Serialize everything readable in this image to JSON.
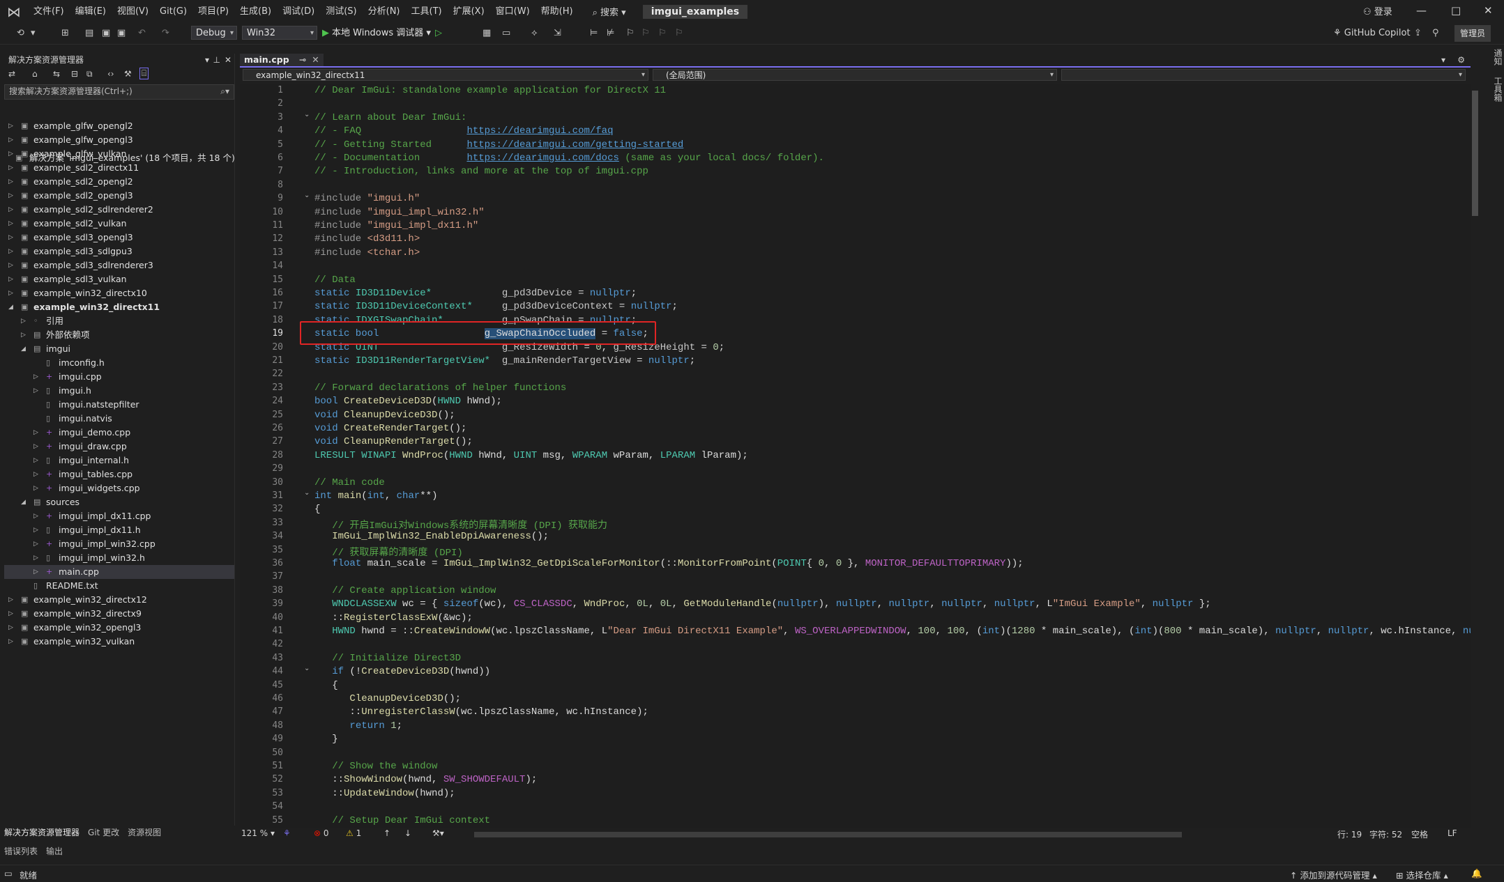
{
  "titlebar": {
    "menus": [
      "文件(F)",
      "编辑(E)",
      "视图(V)",
      "Git(G)",
      "项目(P)",
      "生成(B)",
      "调试(D)",
      "测试(S)",
      "分析(N)",
      "工具(T)",
      "扩展(X)",
      "窗口(W)",
      "帮助(H)"
    ],
    "search": "搜索",
    "solution_name": "imgui_examples",
    "login": "登录",
    "minimize": "—",
    "maximize": "□",
    "close": "✕"
  },
  "toolbar": {
    "config": "Debug",
    "platform": "Win32",
    "run_label": "本地 Windows 调试器",
    "copilot": "GitHub Copilot",
    "manage": "管理员"
  },
  "solution_explorer": {
    "title": "解决方案资源管理器",
    "search_placeholder": "搜索解决方案资源管理器(Ctrl+;)",
    "solution_label": "解决方案 'imgui_examples' (18 个项目，共 18 个)",
    "items": [
      {
        "label": "example_glfw_opengl2",
        "depth": 0,
        "arrow": "closed",
        "icon": "project"
      },
      {
        "label": "example_glfw_opengl3",
        "depth": 0,
        "arrow": "closed",
        "icon": "project"
      },
      {
        "label": "example_glfw_vulkan",
        "depth": 0,
        "arrow": "closed",
        "icon": "project"
      },
      {
        "label": "example_sdl2_directx11",
        "depth": 0,
        "arrow": "closed",
        "icon": "project"
      },
      {
        "label": "example_sdl2_opengl2",
        "depth": 0,
        "arrow": "closed",
        "icon": "project"
      },
      {
        "label": "example_sdl2_opengl3",
        "depth": 0,
        "arrow": "closed",
        "icon": "project"
      },
      {
        "label": "example_sdl2_sdlrenderer2",
        "depth": 0,
        "arrow": "closed",
        "icon": "project"
      },
      {
        "label": "example_sdl2_vulkan",
        "depth": 0,
        "arrow": "closed",
        "icon": "project"
      },
      {
        "label": "example_sdl3_opengl3",
        "depth": 0,
        "arrow": "closed",
        "icon": "project"
      },
      {
        "label": "example_sdl3_sdlgpu3",
        "depth": 0,
        "arrow": "closed",
        "icon": "project"
      },
      {
        "label": "example_sdl3_sdlrenderer3",
        "depth": 0,
        "arrow": "closed",
        "icon": "project"
      },
      {
        "label": "example_sdl3_vulkan",
        "depth": 0,
        "arrow": "closed",
        "icon": "project"
      },
      {
        "label": "example_win32_directx10",
        "depth": 0,
        "arrow": "closed",
        "icon": "project"
      },
      {
        "label": "example_win32_directx11",
        "depth": 0,
        "arrow": "open",
        "icon": "project",
        "bold": true
      },
      {
        "label": "引用",
        "depth": 1,
        "arrow": "closed",
        "icon": "ref"
      },
      {
        "label": "外部依赖项",
        "depth": 1,
        "arrow": "closed",
        "icon": "folder"
      },
      {
        "label": "imgui",
        "depth": 1,
        "arrow": "open",
        "icon": "folder"
      },
      {
        "label": "imconfig.h",
        "depth": 2,
        "arrow": "none",
        "icon": "file"
      },
      {
        "label": "imgui.cpp",
        "depth": 2,
        "arrow": "closed",
        "icon": "cpp"
      },
      {
        "label": "imgui.h",
        "depth": 2,
        "arrow": "closed",
        "icon": "file"
      },
      {
        "label": "imgui.natstepfilter",
        "depth": 2,
        "arrow": "none",
        "icon": "file"
      },
      {
        "label": "imgui.natvis",
        "depth": 2,
        "arrow": "none",
        "icon": "file"
      },
      {
        "label": "imgui_demo.cpp",
        "depth": 2,
        "arrow": "closed",
        "icon": "cpp"
      },
      {
        "label": "imgui_draw.cpp",
        "depth": 2,
        "arrow": "closed",
        "icon": "cpp"
      },
      {
        "label": "imgui_internal.h",
        "depth": 2,
        "arrow": "closed",
        "icon": "file"
      },
      {
        "label": "imgui_tables.cpp",
        "depth": 2,
        "arrow": "closed",
        "icon": "cpp"
      },
      {
        "label": "imgui_widgets.cpp",
        "depth": 2,
        "arrow": "closed",
        "icon": "cpp"
      },
      {
        "label": "sources",
        "depth": 1,
        "arrow": "open",
        "icon": "folder"
      },
      {
        "label": "imgui_impl_dx11.cpp",
        "depth": 2,
        "arrow": "closed",
        "icon": "cpp"
      },
      {
        "label": "imgui_impl_dx11.h",
        "depth": 2,
        "arrow": "closed",
        "icon": "file"
      },
      {
        "label": "imgui_impl_win32.cpp",
        "depth": 2,
        "arrow": "closed",
        "icon": "cpp"
      },
      {
        "label": "imgui_impl_win32.h",
        "depth": 2,
        "arrow": "closed",
        "icon": "file"
      },
      {
        "label": "main.cpp",
        "depth": 2,
        "arrow": "closed",
        "icon": "cpp",
        "selected": true
      },
      {
        "label": "README.txt",
        "depth": 1,
        "arrow": "none",
        "icon": "file"
      },
      {
        "label": "example_win32_directx12",
        "depth": 0,
        "arrow": "closed",
        "icon": "project"
      },
      {
        "label": "example_win32_directx9",
        "depth": 0,
        "arrow": "closed",
        "icon": "project"
      },
      {
        "label": "example_win32_opengl3",
        "depth": 0,
        "arrow": "closed",
        "icon": "project"
      },
      {
        "label": "example_win32_vulkan",
        "depth": 0,
        "arrow": "closed",
        "icon": "project"
      }
    ],
    "bottom_tabs": [
      "解决方案资源管理器",
      "Git 更改",
      "资源视图"
    ]
  },
  "editor": {
    "tab_label": "main.cpp",
    "nav_project": "example_win32_directx11",
    "nav_scope": "(全局范围)",
    "current_line": 19,
    "lines": [
      [
        [
          "c",
          "// Dear ImGui: standalone example application for DirectX 11"
        ]
      ],
      [],
      [
        [
          "c",
          "// Learn about Dear ImGui:"
        ]
      ],
      [
        [
          "c",
          "// - FAQ                  "
        ],
        [
          "u",
          "https://dearimgui.com/faq"
        ]
      ],
      [
        [
          "c",
          "// - Getting Started      "
        ],
        [
          "u",
          "https://dearimgui.com/getting-started"
        ]
      ],
      [
        [
          "c",
          "// - Documentation        "
        ],
        [
          "u",
          "https://dearimgui.com/docs"
        ],
        [
          "c",
          " (same as your local docs/ folder)."
        ]
      ],
      [
        [
          "c",
          "// - Introduction, links and more at the top of imgui.cpp"
        ]
      ],
      [],
      [
        [
          "p",
          "#include "
        ],
        [
          "s",
          "\"imgui.h\""
        ]
      ],
      [
        [
          "p",
          "#include "
        ],
        [
          "s",
          "\"imgui_impl_win32.h\""
        ]
      ],
      [
        [
          "p",
          "#include "
        ],
        [
          "s",
          "\"imgui_impl_dx11.h\""
        ]
      ],
      [
        [
          "p",
          "#include "
        ],
        [
          "s",
          "<d3d11.h>"
        ]
      ],
      [
        [
          "p",
          "#include "
        ],
        [
          "s",
          "<tchar.h>"
        ]
      ],
      [],
      [
        [
          "c",
          "// Data"
        ]
      ],
      [
        [
          "k",
          "static "
        ],
        [
          "t",
          "ID3D11Device*"
        ],
        [
          "",
          "            "
        ],
        [
          "g",
          "g_pd3dDevice"
        ],
        [
          "",
          " = "
        ],
        [
          "k",
          "nullptr"
        ],
        [
          "",
          ";"
        ]
      ],
      [
        [
          "k",
          "static "
        ],
        [
          "t",
          "ID3D11DeviceContext*"
        ],
        [
          "",
          "     "
        ],
        [
          "g",
          "g_pd3dDeviceContext"
        ],
        [
          "",
          " = "
        ],
        [
          "k",
          "nullptr"
        ],
        [
          "",
          ";"
        ]
      ],
      [
        [
          "k",
          "static "
        ],
        [
          "t",
          "IDXGISwapChain*"
        ],
        [
          "",
          "          "
        ],
        [
          "g",
          "g_pSwapChain"
        ],
        [
          "",
          " = "
        ],
        [
          "k",
          "nullptr"
        ],
        [
          "",
          ";"
        ]
      ],
      [
        [
          "k",
          "static bool"
        ],
        [
          "",
          "                  "
        ],
        [
          "hl",
          "g_SwapChainOccluded"
        ],
        [
          "",
          " = "
        ],
        [
          "k",
          "false"
        ],
        [
          "",
          ";"
        ]
      ],
      [
        [
          "k",
          "static "
        ],
        [
          "t",
          "UINT"
        ],
        [
          "",
          "                     "
        ],
        [
          "g",
          "g_ResizeWidth"
        ],
        [
          "",
          " = "
        ],
        [
          "n",
          "0"
        ],
        [
          "",
          ", "
        ],
        [
          "g",
          "g_ResizeHeight"
        ],
        [
          "",
          " = "
        ],
        [
          "n",
          "0"
        ],
        [
          "",
          ";"
        ]
      ],
      [
        [
          "k",
          "static "
        ],
        [
          "t",
          "ID3D11RenderTargetView*"
        ],
        [
          "",
          "  "
        ],
        [
          "g",
          "g_mainRenderTargetView"
        ],
        [
          "",
          " = "
        ],
        [
          "k",
          "nullptr"
        ],
        [
          "",
          ";"
        ]
      ],
      [],
      [
        [
          "c",
          "// Forward declarations of helper functions"
        ]
      ],
      [
        [
          "k",
          "bool "
        ],
        [
          "f",
          "CreateDeviceD3D"
        ],
        [
          "",
          "("
        ],
        [
          "t",
          "HWND"
        ],
        [
          "",
          " hWnd);"
        ]
      ],
      [
        [
          "k",
          "void "
        ],
        [
          "f",
          "CleanupDeviceD3D"
        ],
        [
          "",
          "();"
        ]
      ],
      [
        [
          "k",
          "void "
        ],
        [
          "f",
          "CreateRenderTarget"
        ],
        [
          "",
          "();"
        ]
      ],
      [
        [
          "k",
          "void "
        ],
        [
          "f",
          "CleanupRenderTarget"
        ],
        [
          "",
          "();"
        ]
      ],
      [
        [
          "t",
          "LRESULT WINAPI "
        ],
        [
          "f",
          "WndProc"
        ],
        [
          "",
          "("
        ],
        [
          "t",
          "HWND"
        ],
        [
          "",
          " hWnd, "
        ],
        [
          "t",
          "UINT"
        ],
        [
          "",
          " msg, "
        ],
        [
          "t",
          "WPARAM"
        ],
        [
          "",
          " wParam, "
        ],
        [
          "t",
          "LPARAM"
        ],
        [
          "",
          " lParam);"
        ]
      ],
      [],
      [
        [
          "c",
          "// Main code"
        ]
      ],
      [
        [
          "k",
          "int "
        ],
        [
          "f",
          "main"
        ],
        [
          "",
          "("
        ],
        [
          "k",
          "int"
        ],
        [
          "",
          ", "
        ],
        [
          "k",
          "char"
        ],
        [
          "",
          "**)"
        ]
      ],
      [
        [
          "",
          "{"
        ]
      ],
      [
        [
          "",
          "   "
        ],
        [
          "c",
          "// 开启ImGui对Windows系统的屏幕清晰度 (DPI) 获取能力"
        ]
      ],
      [
        [
          "",
          "   "
        ],
        [
          "f",
          "ImGui_ImplWin32_EnableDpiAwareness"
        ],
        [
          "",
          "();"
        ]
      ],
      [
        [
          "",
          "   "
        ],
        [
          "c",
          "// 获取屏幕的清晰度 (DPI)"
        ]
      ],
      [
        [
          "",
          "   "
        ],
        [
          "k",
          "float "
        ],
        [
          "",
          "main_scale = "
        ],
        [
          "f",
          "ImGui_ImplWin32_GetDpiScaleForMonitor"
        ],
        [
          "",
          "(::"
        ],
        [
          "f",
          "MonitorFromPoint"
        ],
        [
          "",
          "("
        ],
        [
          "t",
          "POINT"
        ],
        [
          "",
          "{ "
        ],
        [
          "n",
          "0"
        ],
        [
          "",
          ", "
        ],
        [
          "n",
          "0"
        ],
        [
          "",
          " }, "
        ],
        [
          "m",
          "MONITOR_DEFAULTTOPRIMARY"
        ],
        [
          "",
          "));"
        ]
      ],
      [],
      [
        [
          "",
          "   "
        ],
        [
          "c",
          "// Create application window"
        ]
      ],
      [
        [
          "",
          "   "
        ],
        [
          "t",
          "WNDCLASSEXW"
        ],
        [
          "",
          " wc = { "
        ],
        [
          "k",
          "sizeof"
        ],
        [
          "",
          "(wc), "
        ],
        [
          "m",
          "CS_CLASSDC"
        ],
        [
          "",
          ", "
        ],
        [
          "f",
          "WndProc"
        ],
        [
          "",
          ", "
        ],
        [
          "n",
          "0L"
        ],
        [
          "",
          ", "
        ],
        [
          "n",
          "0L"
        ],
        [
          "",
          ", "
        ],
        [
          "f",
          "GetModuleHandle"
        ],
        [
          "",
          "("
        ],
        [
          "k",
          "nullptr"
        ],
        [
          "",
          "), "
        ],
        [
          "k",
          "nullptr"
        ],
        [
          "",
          ", "
        ],
        [
          "k",
          "nullptr"
        ],
        [
          "",
          ", "
        ],
        [
          "k",
          "nullptr"
        ],
        [
          "",
          ", "
        ],
        [
          "k",
          "nullptr"
        ],
        [
          "",
          ", L"
        ],
        [
          "s",
          "\"ImGui Example\""
        ],
        [
          "",
          ", "
        ],
        [
          "k",
          "nullptr"
        ],
        [
          "",
          " };"
        ]
      ],
      [
        [
          "",
          "   ::"
        ],
        [
          "f",
          "RegisterClassExW"
        ],
        [
          "",
          "(&wc);"
        ]
      ],
      [
        [
          "",
          "   "
        ],
        [
          "t",
          "HWND"
        ],
        [
          "",
          " hwnd = ::"
        ],
        [
          "f",
          "CreateWindowW"
        ],
        [
          "",
          "(wc.lpszClassName, L"
        ],
        [
          "s",
          "\"Dear ImGui DirectX11 Example\""
        ],
        [
          "",
          ", "
        ],
        [
          "m",
          "WS_OVERLAPPEDWINDOW"
        ],
        [
          "",
          ", "
        ],
        [
          "n",
          "100"
        ],
        [
          "",
          ", "
        ],
        [
          "n",
          "100"
        ],
        [
          "",
          ", ("
        ],
        [
          "k",
          "int"
        ],
        [
          "",
          ")("
        ],
        [
          "n",
          "1280"
        ],
        [
          "",
          " * main_scale), ("
        ],
        [
          "k",
          "int"
        ],
        [
          "",
          ")("
        ],
        [
          "n",
          "800"
        ],
        [
          "",
          " * main_scale), "
        ],
        [
          "k",
          "nullptr"
        ],
        [
          "",
          ", "
        ],
        [
          "k",
          "nullptr"
        ],
        [
          "",
          ", wc.hInstance, "
        ],
        [
          "k",
          "nullptr"
        ],
        [
          "",
          ");"
        ]
      ],
      [],
      [
        [
          "",
          "   "
        ],
        [
          "c",
          "// Initialize Direct3D"
        ]
      ],
      [
        [
          "",
          "   "
        ],
        [
          "k",
          "if"
        ],
        [
          "",
          " (!"
        ],
        [
          "f",
          "CreateDeviceD3D"
        ],
        [
          "",
          "(hwnd))"
        ]
      ],
      [
        [
          "",
          "   {"
        ]
      ],
      [
        [
          "",
          "      "
        ],
        [
          "f",
          "CleanupDeviceD3D"
        ],
        [
          "",
          "();"
        ]
      ],
      [
        [
          "",
          "      ::"
        ],
        [
          "f",
          "UnregisterClassW"
        ],
        [
          "",
          "(wc.lpszClassName, wc.hInstance);"
        ]
      ],
      [
        [
          "",
          "      "
        ],
        [
          "k",
          "return "
        ],
        [
          "n",
          "1"
        ],
        [
          "",
          ";"
        ]
      ],
      [
        [
          "",
          "   }"
        ]
      ],
      [],
      [
        [
          "",
          "   "
        ],
        [
          "c",
          "// Show the window"
        ]
      ],
      [
        [
          "",
          "   ::"
        ],
        [
          "f",
          "ShowWindow"
        ],
        [
          "",
          "(hwnd, "
        ],
        [
          "m",
          "SW_SHOWDEFAULT"
        ],
        [
          "",
          ");"
        ]
      ],
      [
        [
          "",
          "   ::"
        ],
        [
          "f",
          "UpdateWindow"
        ],
        [
          "",
          "(hwnd);"
        ]
      ],
      [],
      [
        [
          "",
          "   "
        ],
        [
          "c",
          "// Setup Dear ImGui context"
        ]
      ]
    ],
    "fold_lines": [
      3,
      9,
      31,
      44
    ]
  },
  "editor_status": {
    "zoom": "121 %",
    "errors": "0",
    "warnings": "1",
    "line": "行: 19",
    "char": "字符: 52",
    "whitespace": "空格",
    "eol": "LF"
  },
  "output_tabs": [
    "错误列表",
    "输出"
  ],
  "statusbar": {
    "ready": "就绪",
    "add_source": "添加到源代码管理",
    "select_repo": "选择仓库"
  },
  "right_rail": [
    "通知",
    "工具箱"
  ]
}
